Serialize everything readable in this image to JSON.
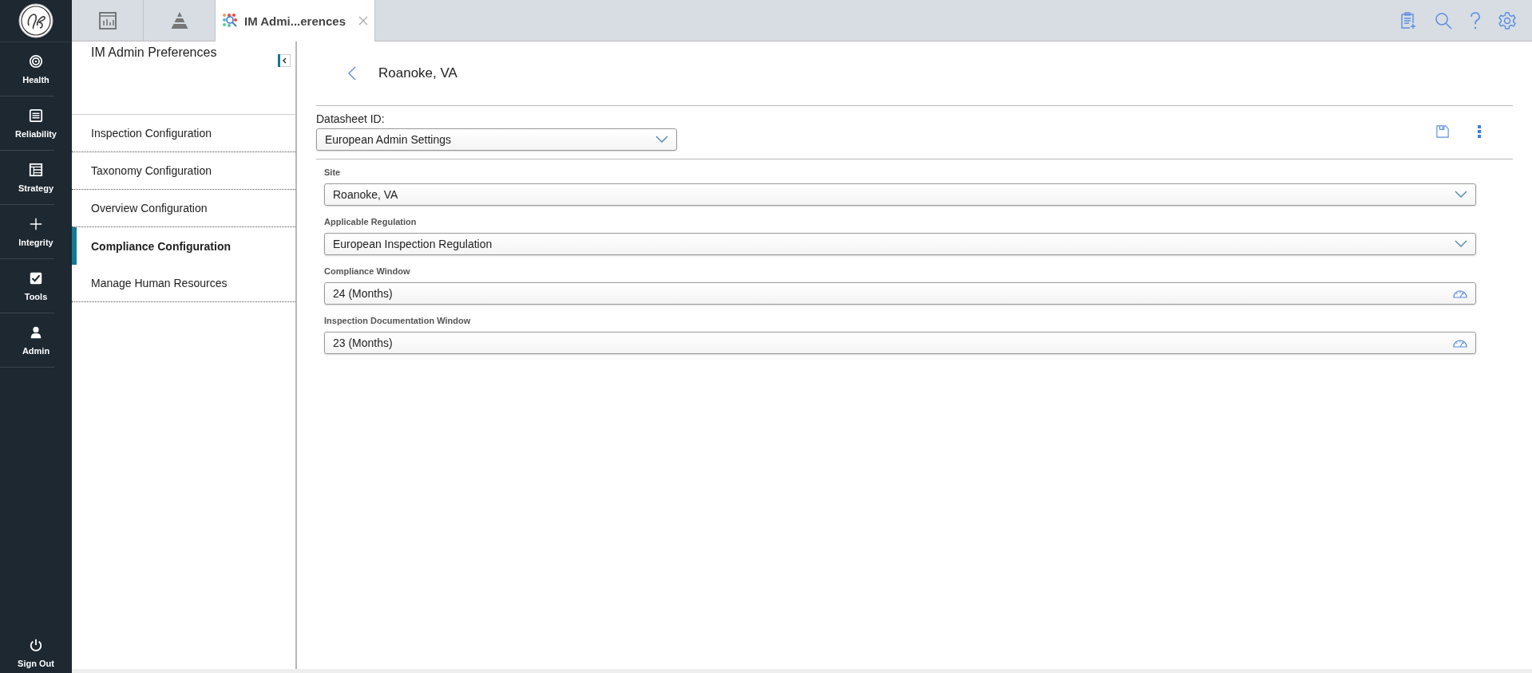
{
  "nav": {
    "items": [
      {
        "kind": "health",
        "label": "Health"
      },
      {
        "kind": "reliability",
        "label": "Reliability"
      },
      {
        "kind": "strategy",
        "label": "Strategy"
      },
      {
        "kind": "integrity",
        "label": "Integrity"
      },
      {
        "kind": "tools",
        "label": "Tools"
      },
      {
        "kind": "admin",
        "label": "Admin"
      }
    ],
    "sign_out": "Sign Out"
  },
  "tabs": [
    {
      "kind": "chart",
      "selected": false
    },
    {
      "kind": "pyramid",
      "selected": false
    },
    {
      "kind": "labeled",
      "label": "IM Admi...erences",
      "selected": true
    }
  ],
  "panel": {
    "title": "IM Admin Preferences",
    "items": [
      {
        "label": "Inspection Configuration",
        "selected": false
      },
      {
        "label": "Taxonomy Configuration",
        "selected": false
      },
      {
        "label": "Overview Configuration",
        "selected": false
      },
      {
        "label": "Compliance Configuration",
        "selected": true
      },
      {
        "label": "Manage Human Resources",
        "selected": false
      }
    ]
  },
  "header": {
    "title": "Roanoke, VA"
  },
  "datasheet": {
    "label": "Datasheet ID:",
    "value": "European Admin Settings"
  },
  "fields": [
    {
      "kind": "select",
      "label": "Site",
      "value": "Roanoke, VA"
    },
    {
      "kind": "select",
      "label": "Applicable Regulation",
      "value": "European Inspection Regulation"
    },
    {
      "kind": "number",
      "label": "Compliance Window",
      "value": "24 (Months)"
    },
    {
      "kind": "number",
      "label": "Inspection Documentation Window",
      "value": "23 (Months)"
    }
  ]
}
